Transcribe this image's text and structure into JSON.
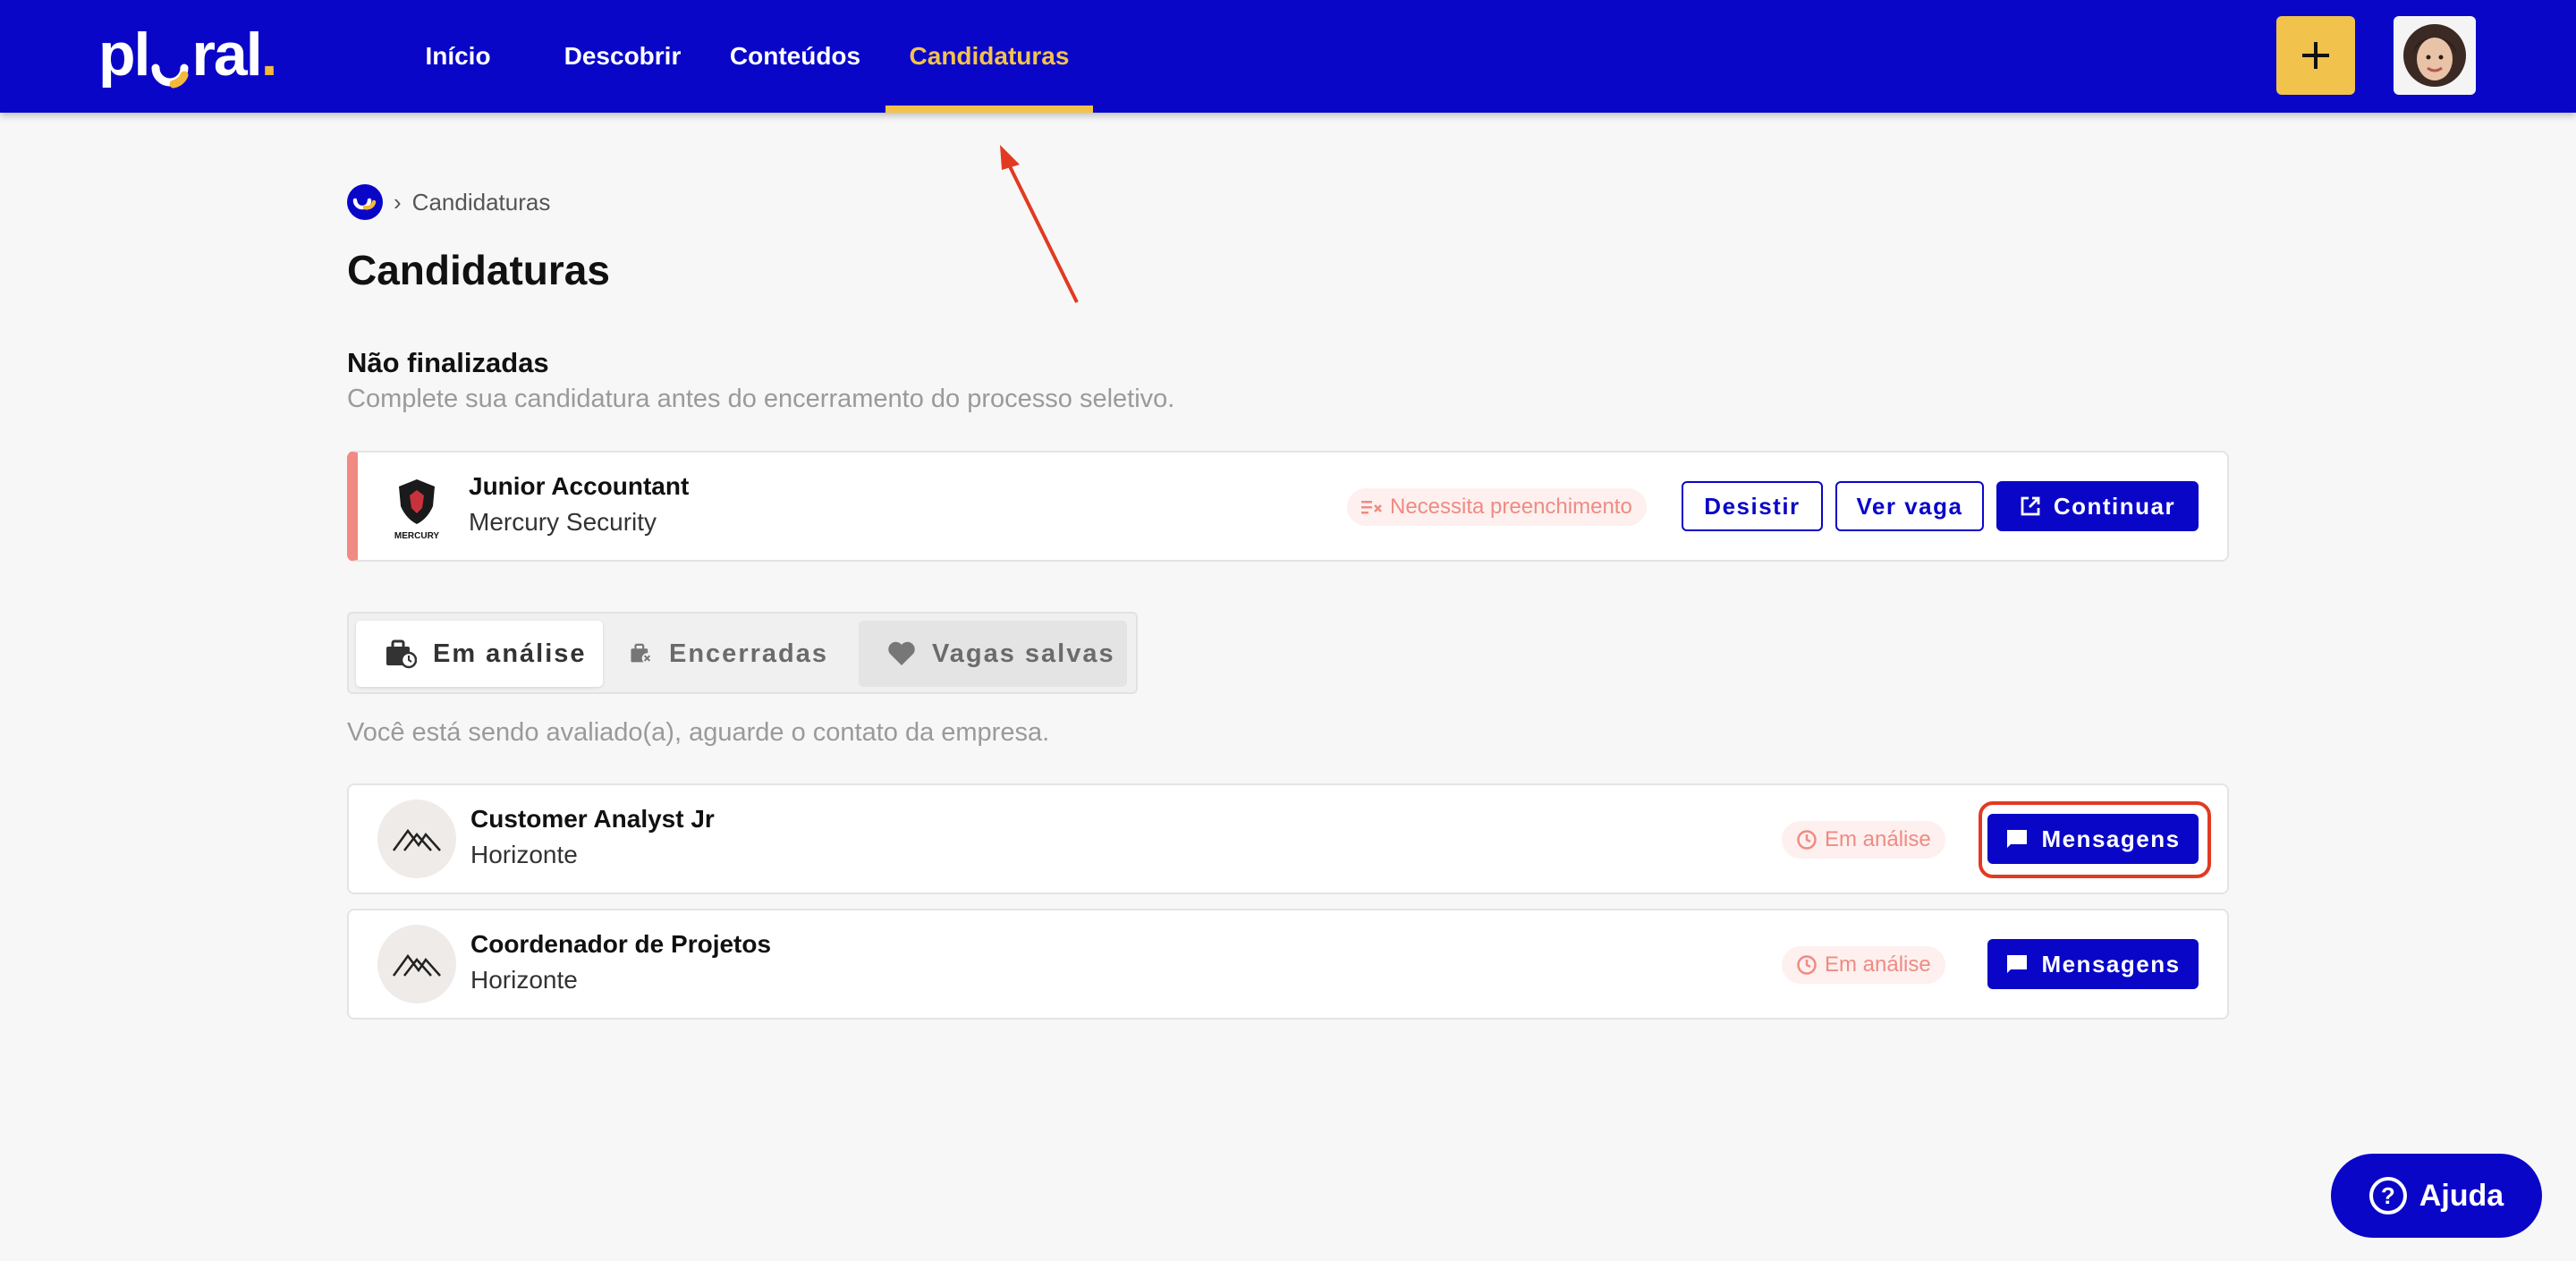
{
  "nav": {
    "logo_text_left": "pl",
    "logo_text_right": "ral",
    "logo_dot": ".",
    "items": [
      {
        "label": "Início"
      },
      {
        "label": "Descobrir"
      },
      {
        "label": "Conteúdos"
      },
      {
        "label": "Candidaturas",
        "active": true
      }
    ],
    "plus_label": "+"
  },
  "breadcrumb": {
    "separator": "›",
    "current": "Candidaturas"
  },
  "page": {
    "title": "Candidaturas"
  },
  "pending": {
    "title": "Não finalizadas",
    "subtitle": "Complete sua candidatura antes do encerramento do processo seletivo.",
    "item": {
      "logo_text": "MERCURY",
      "job_title": "Junior Accountant",
      "company": "Mercury Security",
      "badge": "Necessita preenchimento",
      "actions": {
        "withdraw": "Desistir",
        "view": "Ver vaga",
        "continue": "Continuar"
      }
    }
  },
  "tabs": {
    "items": [
      {
        "label": "Em análise",
        "icon": "briefcase-clock-icon"
      },
      {
        "label": "Encerradas",
        "icon": "briefcase-x-icon"
      },
      {
        "label": "Vagas salvas",
        "icon": "heart-icon"
      }
    ],
    "subtitle": "Você está sendo avaliado(a), aguarde o contato da empresa."
  },
  "applications": [
    {
      "job_title": "Customer Analyst Jr",
      "company": "Horizonte",
      "status": "Em análise",
      "action": "Mensagens"
    },
    {
      "job_title": "Coordenador de Projetos",
      "company": "Horizonte",
      "status": "Em análise",
      "action": "Mensagens"
    }
  ],
  "help": {
    "label": "Ajuda",
    "icon_glyph": "?"
  },
  "colors": {
    "brand": "#0a06c8",
    "accent": "#f3c24c",
    "warning": "#ef8b82",
    "annotation": "#e23a22"
  }
}
